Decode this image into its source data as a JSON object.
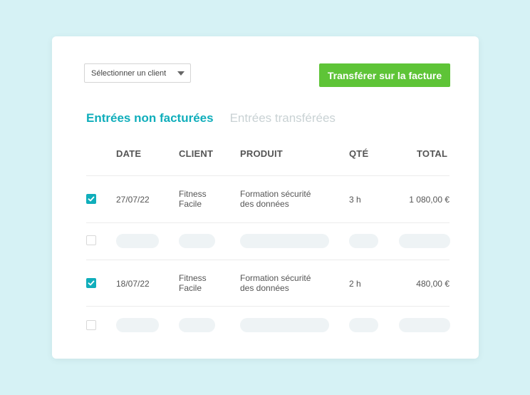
{
  "controls": {
    "client_select_value": "Sélectionner un client",
    "transfer_button_label": "Transférer sur la facture"
  },
  "tabs": [
    {
      "label": "Entrées non facturées",
      "active": true
    },
    {
      "label": "Entrées transférées",
      "active": false
    }
  ],
  "table": {
    "headers": {
      "date": "DATE",
      "client": "CLIENT",
      "product": "PRODUIT",
      "qty": "QTÉ",
      "total": "TOTAL"
    },
    "rows": [
      {
        "checked": true,
        "date": "27/07/22",
        "client_line1": "Fitness",
        "client_line2": "Facile",
        "product_line1": "Formation sécurité",
        "product_line2": "des données",
        "qty": "3 h",
        "total": "1 080,00 €"
      },
      {
        "checked": true,
        "date": "18/07/22",
        "client_line1": "Fitness",
        "client_line2": "Facile",
        "product_line1": "Formation sécurité",
        "product_line2": "des données",
        "qty": "2 h",
        "total": "480,00 €"
      }
    ]
  },
  "colors": {
    "accent": "#10aebb",
    "button": "#5ec437",
    "background": "#d6f2f5"
  },
  "icons": {
    "checkbox_checked": "checkmark-icon",
    "select_caret": "caret-down-icon"
  }
}
